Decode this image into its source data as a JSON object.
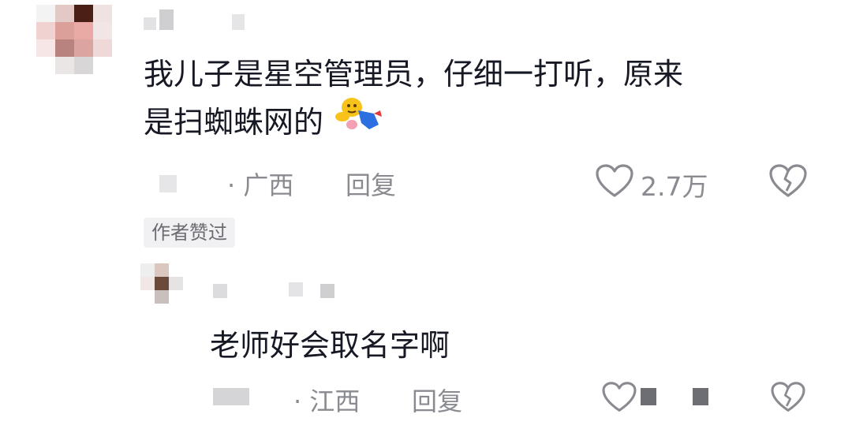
{
  "main_comment": {
    "text_line1": "我儿子是星空管理员，仔细一打听，原来",
    "text_line2": "是扫蜘蛛网的",
    "emoji": "sweeping-emoji",
    "location": "· 广西",
    "reply_label": "回复",
    "like_count": "2.7万",
    "author_badge": "作者赞过"
  },
  "reply_comment": {
    "text": "老师好会取名字啊",
    "location": "· 江西",
    "reply_label": "回复"
  },
  "icons": {
    "like": "heart-outline-icon",
    "dislike": "broken-heart-icon"
  },
  "colors": {
    "text_primary": "#161823",
    "text_secondary": "#8a8b91",
    "badge_bg": "#f1f1f3"
  }
}
